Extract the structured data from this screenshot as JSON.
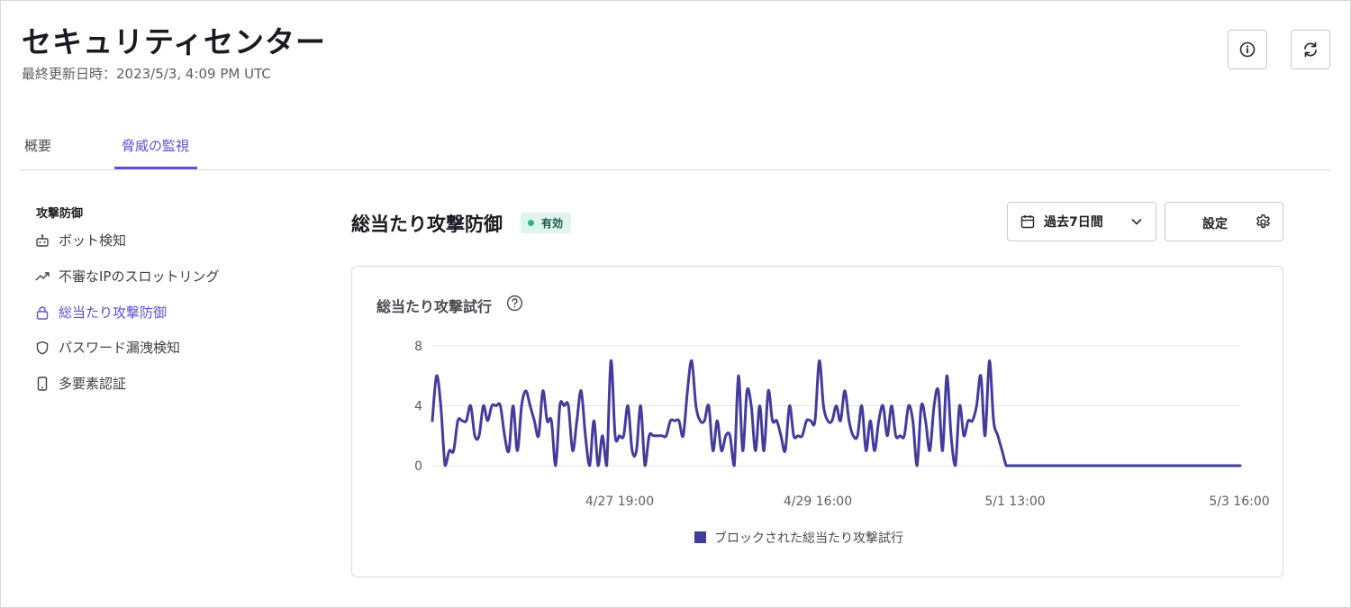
{
  "header": {
    "title": "セキュリティセンター",
    "last_updated": "最終更新日時：2023/5/3, 4:09 PM UTC"
  },
  "toolbar": {
    "info_icon": "info-icon",
    "refresh_icon": "refresh-icon"
  },
  "tabs": [
    {
      "label": "概要",
      "active": false
    },
    {
      "label": "脅威の監視",
      "active": true
    }
  ],
  "sidebar": {
    "heading": "攻撃防御",
    "items": [
      {
        "label": "ボット検知",
        "icon": "robot-icon",
        "active": false
      },
      {
        "label": "不審なIPのスロットリング",
        "icon": "trend-up-icon",
        "active": false
      },
      {
        "label": "総当たり攻撃防御",
        "icon": "lock-icon",
        "active": true
      },
      {
        "label": "パスワード漏洩検知",
        "icon": "shield-icon",
        "active": false
      },
      {
        "label": "多要素認証",
        "icon": "phone-icon",
        "active": false
      }
    ]
  },
  "section": {
    "title": "総当たり攻撃防御",
    "status": "有効",
    "range_label": "過去7日間",
    "settings_label": "設定"
  },
  "colors": {
    "accent": "#5b52d6",
    "series": "#433c9c",
    "status_bg": "#dff4ee",
    "status_dot": "#2fb48f"
  },
  "chart_data": {
    "type": "line",
    "title": "総当たり攻撃試行",
    "ylim": [
      0,
      8
    ],
    "y_ticks": [
      "0",
      "4",
      "8"
    ],
    "x_tick_labels": [
      "4/27 19:00",
      "4/29 16:00",
      "5/1 13:00",
      "5/3 16:00"
    ],
    "grid": true,
    "legend_position": "bottom",
    "series": [
      {
        "name": "ブロックされた総当たり攻撃試行",
        "values": [
          3,
          6,
          4,
          0,
          1,
          1,
          3,
          3,
          3,
          4,
          2,
          2,
          4,
          3,
          4,
          4,
          4,
          2,
          1,
          4,
          1,
          4,
          5,
          4,
          3,
          2,
          5,
          3,
          3,
          0,
          4,
          4,
          4,
          1,
          3,
          5,
          2,
          0,
          3,
          0,
          2,
          0,
          7,
          2,
          2,
          2,
          4,
          1,
          1,
          4,
          0,
          2,
          2,
          2,
          2,
          2,
          3,
          3,
          3,
          2,
          5,
          7,
          4,
          3,
          3,
          4,
          1,
          3,
          1,
          2,
          2,
          0,
          6,
          1,
          5,
          4,
          1,
          4,
          1,
          5,
          3,
          3,
          2,
          1,
          4,
          2,
          2,
          2,
          3,
          3,
          3,
          7,
          4,
          3,
          3,
          4,
          3,
          5,
          3,
          2,
          2,
          4,
          1,
          3,
          1,
          3,
          4,
          2,
          4,
          2,
          2,
          2,
          4,
          3,
          0,
          4,
          3,
          1,
          4,
          5,
          1,
          6,
          2,
          0,
          4,
          2,
          3,
          3,
          4,
          6,
          2,
          7,
          3,
          2,
          1,
          0,
          0,
          0,
          0,
          0,
          0,
          0,
          0,
          0,
          0,
          0,
          0,
          0,
          0,
          0,
          0,
          0,
          0,
          0,
          0,
          0,
          0,
          0,
          0,
          0,
          0,
          0,
          0,
          0,
          0,
          0,
          0,
          0,
          0,
          0,
          0,
          0,
          0,
          0,
          0,
          0,
          0,
          0,
          0,
          0,
          0,
          0,
          0,
          0,
          0,
          0,
          0,
          0,
          0,
          0,
          0
        ]
      }
    ]
  }
}
